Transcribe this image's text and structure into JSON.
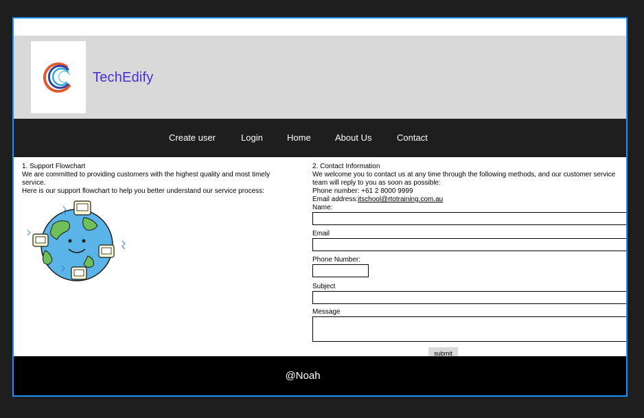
{
  "brand": {
    "name": "TechEdify",
    "logo_icon": "swirl-circle-logo"
  },
  "nav": {
    "items": [
      {
        "label": "Create user"
      },
      {
        "label": "Login"
      },
      {
        "label": "Home"
      },
      {
        "label": "About Us"
      },
      {
        "label": "Contact"
      }
    ]
  },
  "support": {
    "heading": "1. Support Flowchart",
    "line1": "We are committed to providing customers with the highest quality and most timely service.",
    "line2": "Here is our support flowchart to help you better understand our service process:",
    "image_icon": "earth-with-computers-illustration"
  },
  "contact": {
    "heading": "2. Contact Information",
    "intro": "We welcome you to contact us at any time through the following methods, and our customer service team will reply to you as soon as possible:",
    "phone": "Phone number: +61 2 8000 9999",
    "email_label": "Email address:",
    "email_value": "itschool@rtotraining.com.au",
    "form": {
      "name_label": "Name:",
      "email_label": "Email",
      "phone_label": "Phone Number:",
      "subject_label": "Subject",
      "message_label": "Message",
      "submit_label": "submit"
    }
  },
  "footer": {
    "text": "@Noah"
  },
  "colors": {
    "brand": "#4a2bd6",
    "frame_border": "#1e90ff",
    "nav_bg": "#1e1e1e",
    "header_bg": "#d9d9d9",
    "footer_bg": "#000000"
  }
}
